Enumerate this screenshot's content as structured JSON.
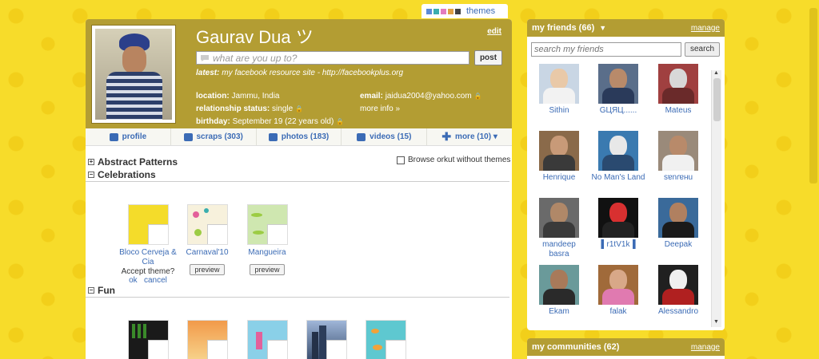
{
  "themes_bar": {
    "label": "themes",
    "swatches": [
      "#5b8bd6",
      "#3aaeae",
      "#e37cbd",
      "#e0a044",
      "#444444"
    ]
  },
  "profile": {
    "name": "Gaurav Dua ツ",
    "edit_label": "edit",
    "status_placeholder": "what are you up to?",
    "post_label": "post",
    "latest_label": "latest:",
    "latest_text": "my facebook resource site - http://facebookplus.org",
    "location_label": "location:",
    "location_value": "Jammu, India",
    "relationship_label": "relationship status:",
    "relationship_value": "single",
    "birthday_label": "birthday:",
    "birthday_value": "September 19 (22 years old)",
    "email_label": "email:",
    "email_value": "jaidua2004@yahoo.com",
    "more_info": "more info »"
  },
  "tabs": [
    {
      "label": "profile"
    },
    {
      "label": "scraps (303)"
    },
    {
      "label": "photos (183)"
    },
    {
      "label": "videos (15)"
    },
    {
      "label": "more (10) ▾"
    }
  ],
  "themes_section": {
    "abstract": "Abstract Patterns",
    "celebrations": "Celebrations",
    "fun": "Fun",
    "browse_label": "Browse orkut without themes",
    "items": [
      {
        "label": "Bloco Cerveja & Cia",
        "accept": "Accept theme?",
        "ok": "ok",
        "cancel": "cancel"
      },
      {
        "label": "Carnaval'10",
        "preview": "preview"
      },
      {
        "label": "Mangueira",
        "preview": "preview"
      }
    ]
  },
  "friends": {
    "title": "my friends (66)",
    "manage": "manage",
    "search_placeholder": "search my friends",
    "search_label": "search",
    "list": [
      {
        "name": "Sithin"
      },
      {
        "name": "GЦЯЦ......"
      },
      {
        "name": "Mateus"
      },
      {
        "name": "Henrique"
      },
      {
        "name": "No Man's Land"
      },
      {
        "name": "sɐnɾɐʜu"
      },
      {
        "name": "mandeep basra"
      },
      {
        "name": "▌r1tV1k▐"
      },
      {
        "name": "Deepak"
      },
      {
        "name": "Ekam"
      },
      {
        "name": "falak"
      },
      {
        "name": "Alessandro"
      }
    ]
  },
  "communities": {
    "title": "my communities (62)",
    "manage": "manage"
  }
}
